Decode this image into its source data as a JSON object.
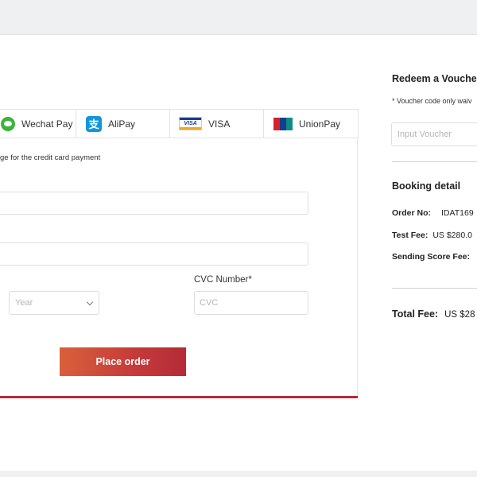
{
  "payment": {
    "tabs": [
      {
        "label": "Wechat Pay",
        "icon": "wechat-icon"
      },
      {
        "label": "AliPay",
        "icon": "alipay-icon"
      },
      {
        "label": "VISA",
        "icon": "visa-icon"
      },
      {
        "label": "UnionPay",
        "icon": "unionpay-icon"
      }
    ],
    "note": "ge for the credit card payment",
    "year_placeholder": "Year",
    "cvc_label": "CVC Number*",
    "cvc_placeholder": "CVC",
    "place_order_label": "Place order",
    "accent_color": "#b8283a"
  },
  "voucher": {
    "title": "Redeem a Voucher",
    "note": "* Voucher code only waiv",
    "placeholder": "Input Voucher"
  },
  "booking": {
    "title": "Booking detail",
    "order_no_label": "Order No:",
    "order_no_value": "IDAT169",
    "test_fee_label": "Test Fee:",
    "test_fee_value": "US $280.0",
    "sending_fee_label": "Sending Score Fee:",
    "total_label": "Total Fee:",
    "total_value": "US $28"
  }
}
